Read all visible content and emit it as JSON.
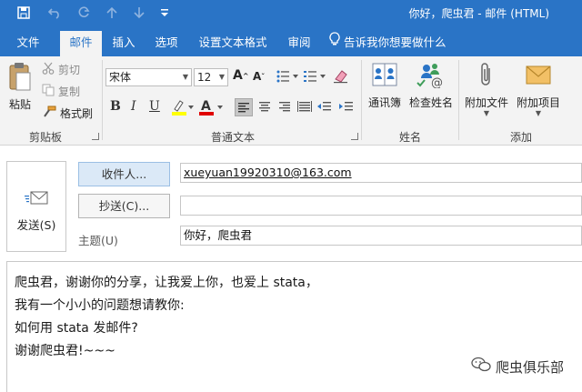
{
  "window": {
    "title": "你好，爬虫君  -  邮件 (HTML)"
  },
  "ribbon_tabs": {
    "file": "文件",
    "message": "邮件",
    "insert": "插入",
    "options": "选项",
    "format_text": "设置文本格式",
    "review": "审阅",
    "tell_me": "告诉我你想要做什么"
  },
  "clipboard": {
    "paste": "粘贴",
    "cut": "剪切",
    "copy": "复制",
    "format_painter": "格式刷",
    "group": "剪贴板"
  },
  "basic_text": {
    "font_name": "宋体",
    "font_size": "12",
    "group": "普通文本"
  },
  "names": {
    "address_book": "通讯簿",
    "check_names": "检查姓名",
    "group": "姓名"
  },
  "include": {
    "attach_file": "附加文件",
    "attach_item": "附加项目",
    "group": "添加"
  },
  "compose": {
    "send": "发送(S)",
    "to_button": "收件人...",
    "cc_button": "抄送(C)...",
    "subject_label": "主题(U)",
    "to_value": "xueyuan19920310@163.com",
    "cc_value": "",
    "subject_value": "你好，爬虫君",
    "body_lines": [
      "爬虫君，谢谢你的分享，让我爱上你，也爱上 stata，",
      "我有一个小小的问题想请教你:",
      "如何用 stata 发邮件?",
      "谢谢爬虫君!~~~"
    ]
  },
  "watermark": {
    "text": "爬虫俱乐部"
  },
  "colors": {
    "accent": "#2a74c6",
    "ribbon_bg": "#f3f3f3",
    "highlight": "#ffff00",
    "font_color": "#e00000"
  },
  "icons": {
    "save": "save-icon",
    "undo": "undo-icon",
    "redo": "redo-icon",
    "up": "arrow-up-icon",
    "down": "arrow-down-icon",
    "customize": "customize-qat-icon",
    "lightbulb": "lightbulb-icon",
    "send": "send-envelope-icon",
    "attach": "paperclip-icon",
    "item": "envelope-item-icon",
    "wechat": "wechat-icon"
  }
}
